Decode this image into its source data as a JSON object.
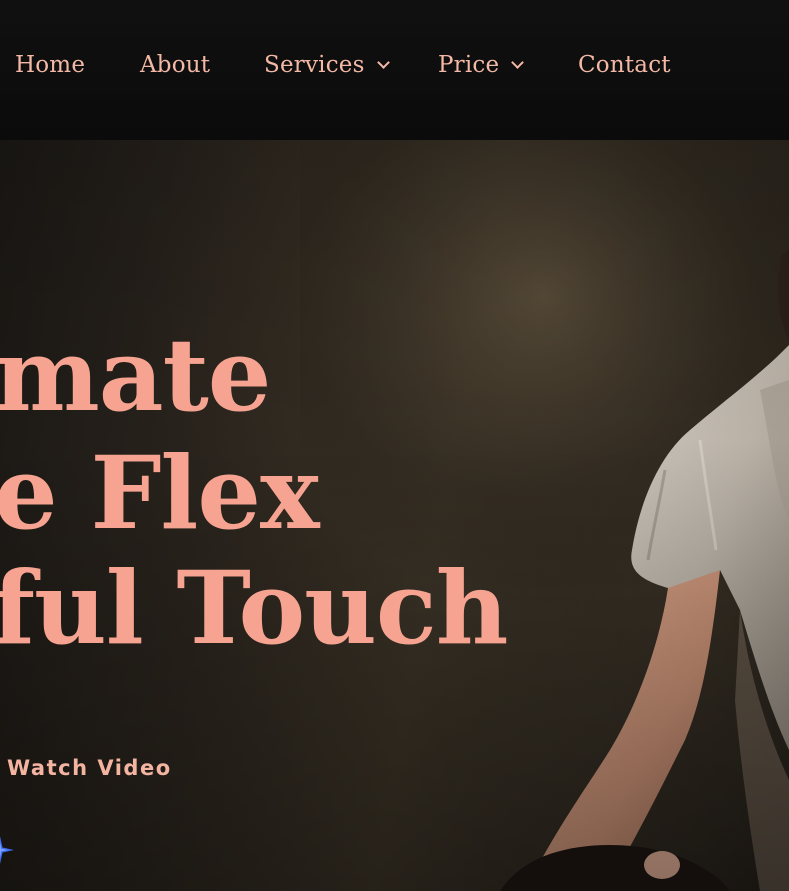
{
  "nav": {
    "items": [
      {
        "label": "Home",
        "has_dropdown": false
      },
      {
        "label": "About",
        "has_dropdown": false
      },
      {
        "label": "Services",
        "has_dropdown": true
      },
      {
        "label": "Price",
        "has_dropdown": true
      },
      {
        "label": "Contact",
        "has_dropdown": false
      }
    ]
  },
  "hero": {
    "headline_lines": [
      "mate",
      "e Flex",
      "ful Touch"
    ],
    "watch_video_label": "Watch Video"
  },
  "colors": {
    "accent": "#f6a491",
    "nav_text": "#f3b8a6",
    "nav_background": "#0b0b0b",
    "sparkle_icon": "#3b6cf0"
  },
  "icons": [
    "chevron-down-icon",
    "sparkle-icon"
  ]
}
